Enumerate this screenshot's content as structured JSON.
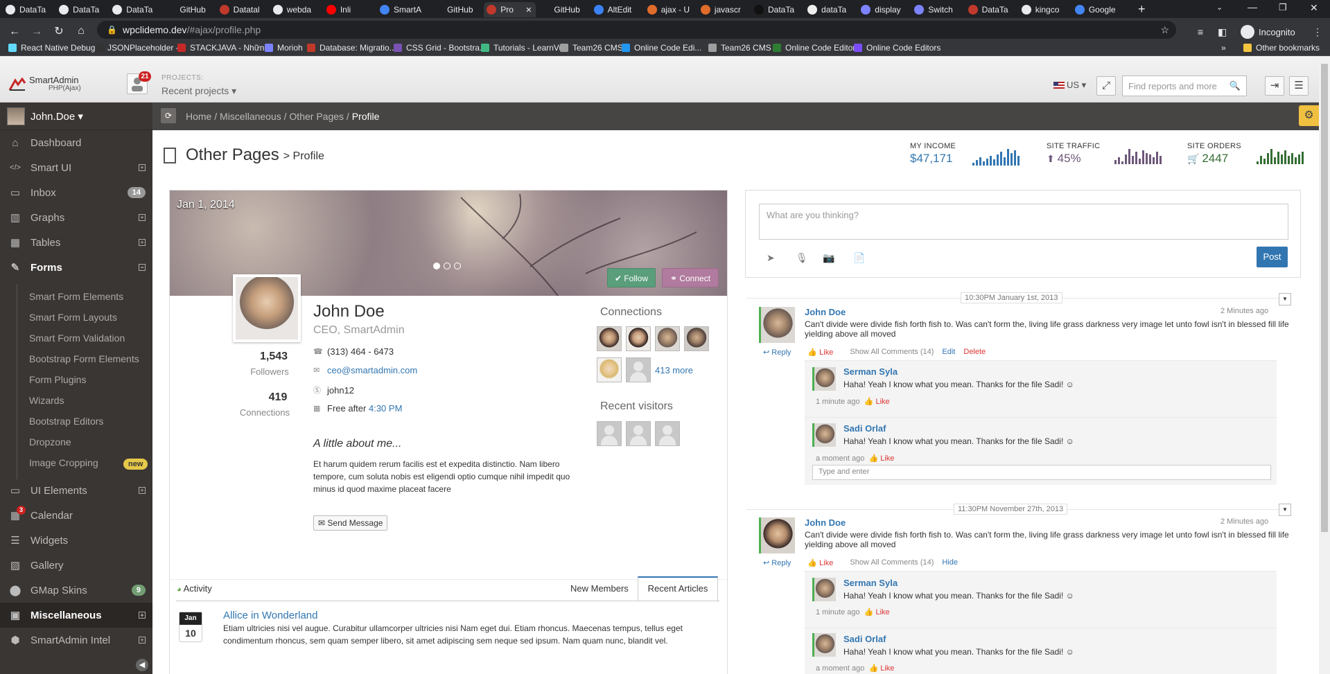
{
  "browser": {
    "tabs": [
      "DataTa",
      "DataTa",
      "DataTa",
      "GitHub",
      "Datatal",
      "webda",
      "Inli",
      "SmartA",
      "GitHub",
      "Pro",
      "GitHub",
      "AltEdit",
      "ajax - U",
      "javascr",
      "DataTa",
      "dataTa",
      "display",
      "Switch",
      "DataTa",
      "kingco",
      "Google"
    ],
    "active_tab_index": 9,
    "url_host": "wpclidemo.dev",
    "url_path": "/#ajax/profile.php",
    "profile_label": "Incognito",
    "bookmarks": [
      "React Native Debug...",
      "JSONPlaceholder -...",
      "STACKJAVA - Nhữn...",
      "Morioh",
      "Database: Migratio...",
      "CSS Grid - Bootstra...",
      "Tutorials - LearnVue",
      "Team26 CMS",
      "Online Code Edi...",
      "Team26 CMS",
      "Online Code Editors",
      "Online Code Editors"
    ],
    "other_bookmarks": "Other bookmarks",
    "overflow": "»"
  },
  "header": {
    "logo_name": "SmartAdmin",
    "logo_sub": "PHP(Ajax)",
    "projects_badge": "21",
    "projects_label": "PROJECTS:",
    "projects_value": "Recent projects ▾",
    "language": "US ▾",
    "search_placeholder": "Find reports and more"
  },
  "sidebar": {
    "user": "John.Doe ▾",
    "items": [
      {
        "label": "Dashboard",
        "icon": "home-icon"
      },
      {
        "label": "Smart UI",
        "icon": "code-icon"
      },
      {
        "label": "Inbox",
        "icon": "inbox-icon",
        "badge": "14"
      },
      {
        "label": "Graphs",
        "icon": "bar-chart-icon"
      },
      {
        "label": "Tables",
        "icon": "table-icon"
      },
      {
        "label": "Forms",
        "icon": "edit-icon"
      },
      {
        "label": "UI Elements",
        "icon": "desktop-icon"
      },
      {
        "label": "Calendar",
        "icon": "calendar-icon",
        "badge": "3"
      },
      {
        "label": "Widgets",
        "icon": "list-icon"
      },
      {
        "label": "Gallery",
        "icon": "picture-icon"
      },
      {
        "label": "GMap Skins",
        "icon": "map-marker-icon",
        "badge": "9"
      },
      {
        "label": "Miscellaneous",
        "icon": "windows-icon"
      },
      {
        "label": "SmartAdmin Intel",
        "icon": "cube-icon"
      }
    ],
    "forms_sub": [
      "Smart Form Elements",
      "Smart Form Layouts",
      "Smart Form Validation",
      "Bootstrap Form Elements",
      "Form Plugins",
      "Wizards",
      "Bootstrap Editors",
      "Dropzone",
      "Image Cropping"
    ],
    "new_badge": "new"
  },
  "breadcrumb": [
    "Home",
    "Miscellaneous",
    "Other Pages",
    "Profile"
  ],
  "page": {
    "title": "Other Pages",
    "subtitle": "> Profile"
  },
  "stats": [
    {
      "label": "MY INCOME",
      "value": "$47,171",
      "color": "#3276b1"
    },
    {
      "label": "SITE TRAFFIC",
      "value": "45%",
      "color": "#6e587a"
    },
    {
      "label": "SITE ORDERS",
      "value": "2447",
      "color": "#356e35"
    }
  ],
  "profile": {
    "cover_date": "Jan 1, 2014",
    "follow": "Follow",
    "connect": "Connect",
    "followers_count": "1,543",
    "followers_label": "Followers",
    "connections_count": "419",
    "connections_label": "Connections",
    "name": "John Doe",
    "role": "CEO, SmartAdmin",
    "phone": "(313) 464 - 6473",
    "email": "ceo@smartadmin.com",
    "skype": "john12",
    "free_prefix": "Free after",
    "free_time": "4:30 PM",
    "about_title": "A little about me...",
    "about_text": "Et harum quidem rerum facilis est et expedita distinctio. Nam libero tempore, cum soluta nobis est eligendi optio cumque nihil impedit quo minus id quod maxime placeat facere",
    "send_message": "Send Message",
    "connections_title": "Connections",
    "more_link": "413 more",
    "visitors_title": "Recent visitors"
  },
  "tabs": {
    "activity": "Activity",
    "new_members": "New Members",
    "recent_articles": "Recent Articles"
  },
  "article": {
    "month": "Jan",
    "day": "10",
    "title": "Allice in Wonderland",
    "text": "Etiam ultricies nisi vel augue. Curabitur ullamcorper ultricies nisi Nam eget dui. Etiam rhoncus. Maecenas tempus, tellus eget condimentum rhoncus, sem quam semper libero, sit amet adipiscing sem neque sed ipsum. Nam quam nunc, blandit vel."
  },
  "post": {
    "placeholder": "What are you thinking?",
    "button": "Post"
  },
  "timeline": [
    {
      "stamp": "10:30PM January 1st, 2013",
      "name": "John Doe",
      "time": "2 Minutes ago",
      "text": "Can't divide were divide fish forth fish to. Was can't form the, living life grass darkness very image let unto fowl isn't in blessed fill life yielding above all moved",
      "actions": [
        "Reply",
        "Like",
        "Show All Comments (14)",
        "Edit",
        "Delete"
      ],
      "replies": [
        {
          "name": "Serman Syla",
          "text": "Haha! Yeah I know what you mean. Thanks for the file Sadi! ☺",
          "time": "1 minute ago",
          "like": "Like"
        },
        {
          "name": "Sadi Orlaf",
          "text": "Haha! Yeah I know what you mean. Thanks for the file Sadi! ☺",
          "time": "a moment ago",
          "like": "Like"
        }
      ],
      "input_placeholder": "Type and enter"
    },
    {
      "stamp": "11:30PM November 27th, 2013",
      "name": "John Doe",
      "time": "2 Minutes ago",
      "text": "Can't divide were divide fish forth fish to. Was can't form the, living life grass darkness very image let unto fowl isn't in blessed fill life yielding above all moved",
      "actions": [
        "Reply",
        "Like",
        "Show All Comments (14)",
        "Hide"
      ],
      "replies": [
        {
          "name": "Serman Syla",
          "text": "Haha! Yeah I know what you mean. Thanks for the file Sadi! ☺",
          "time": "1 minute ago",
          "like": "Like"
        },
        {
          "name": "Sadi Orlaf",
          "text": "Haha! Yeah I know what you mean. Thanks for the file Sadi! ☺",
          "time": "a moment ago",
          "like": "Like"
        }
      ]
    }
  ]
}
